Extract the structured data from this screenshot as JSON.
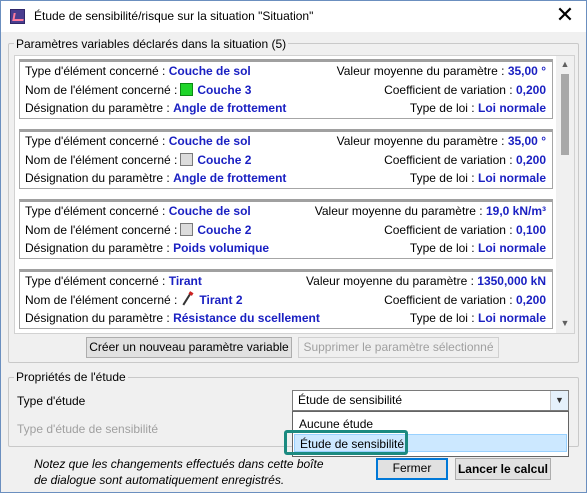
{
  "window": {
    "title": "Étude de sensibilité/risque sur la situation \"Situation\"",
    "close_glyph": "✕"
  },
  "params_group": {
    "label": "Paramètres variables déclarés dans la situation (5)",
    "cards": [
      {
        "type_label": "Type d'élément concerné :",
        "type_value": "Couche de sol",
        "name_label": "Nom de l'élément concerné :",
        "name_value": "Couche 3",
        "icon": "green-swatch-icon",
        "desig_label": "Désignation du paramètre :",
        "desig_value": "Angle de frottement",
        "mean_label": "Valeur moyenne du paramètre :",
        "mean_value": "35,00 °",
        "cv_label": "Coefficient de variation :",
        "cv_value": "0,200",
        "law_label": "Type de loi :",
        "law_value": "Loi normale"
      },
      {
        "type_label": "Type d'élément concerné :",
        "type_value": "Couche de sol",
        "name_label": "Nom de l'élément concerné :",
        "name_value": "Couche 2",
        "icon": "gray-swatch-icon",
        "desig_label": "Désignation du paramètre :",
        "desig_value": "Angle de frottement",
        "mean_label": "Valeur moyenne du paramètre :",
        "mean_value": "35,00 °",
        "cv_label": "Coefficient de variation :",
        "cv_value": "0,200",
        "law_label": "Type de loi :",
        "law_value": "Loi normale"
      },
      {
        "type_label": "Type d'élément concerné :",
        "type_value": "Couche de sol",
        "name_label": "Nom de l'élément concerné :",
        "name_value": "Couche 2",
        "icon": "gray-swatch-icon",
        "desig_label": "Désignation du paramètre :",
        "desig_value": "Poids volumique",
        "mean_label": "Valeur moyenne du paramètre :",
        "mean_value": "19,0 kN/m³",
        "cv_label": "Coefficient de variation :",
        "cv_value": "0,100",
        "law_label": "Type de loi :",
        "law_value": "Loi normale"
      },
      {
        "type_label": "Type d'élément concerné :",
        "type_value": "Tirant",
        "name_label": "Nom de l'élément concerné :",
        "name_value": "Tirant 2",
        "icon": "anchor-icon",
        "desig_label": "Désignation du paramètre :",
        "desig_value": "Résistance du scellement",
        "mean_label": "Valeur moyenne du paramètre :",
        "mean_value": "1350,000 kN",
        "cv_label": "Coefficient de variation :",
        "cv_value": "0,200",
        "law_label": "Type de loi :",
        "law_value": "Loi normale"
      }
    ],
    "create_button": "Créer un nouveau paramètre variable",
    "delete_button": "Supprimer le paramètre sélectionné"
  },
  "props_group": {
    "label": "Propriétés de l'étude",
    "study_type_label": "Type d'étude",
    "study_type_value": "Étude de sensibilité",
    "sensitivity_type_label": "Type d'étude de sensibilité",
    "options": [
      "Aucune étude",
      "Étude de sensibilité"
    ],
    "selected_option": "Étude de sensibilité"
  },
  "footer": {
    "note": "Notez que les changements effectués dans cette boîte de dialogue sont automatiquement enregistrés.",
    "close_button": "Fermer",
    "run_button": "Lancer le calcul"
  },
  "colors": {
    "value_blue": "#1a20c2",
    "highlight": "#1b8a80",
    "accent": "#0078d7"
  }
}
